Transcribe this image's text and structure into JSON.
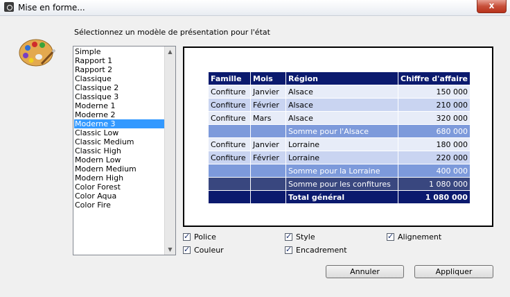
{
  "window": {
    "title": "Mise en forme...",
    "close_label": "x"
  },
  "prompt": "Sélectionnez un modèle de présentation pour l'état",
  "templates": {
    "items": [
      "Simple",
      "Rapport 1",
      "Rapport 2",
      "Classique",
      "Classique 2",
      "Classique 3",
      "Moderne 1",
      "Moderne 2",
      "Moderne 3",
      "Classic Low",
      "Classic Medium",
      "Classic High",
      "Modern Low",
      "Modern Medium",
      "Modern High",
      "Color Forest",
      "Color Aqua",
      "Color Fire"
    ],
    "selected": "Moderne 3"
  },
  "preview": {
    "headers": [
      "Famille",
      "Mois",
      "Région",
      "Chiffre d'affaire"
    ],
    "rows": [
      [
        "Confiture",
        "Janvier",
        "Alsace",
        "150 000"
      ],
      [
        "Confiture",
        "Février",
        "Alsace",
        "210 000"
      ],
      [
        "Confiture",
        "Mars",
        "Alsace",
        "320 000"
      ],
      [
        "",
        "",
        "Somme pour l'Alsace",
        "680 000"
      ],
      [
        "Confiture",
        "Janvier",
        "Lorraine",
        "180 000"
      ],
      [
        "Confiture",
        "Février",
        "Lorraine",
        "220 000"
      ],
      [
        "",
        "",
        "Somme pour la Lorraine",
        "400 000"
      ],
      [
        "",
        "",
        "Somme pour les confitures",
        "1 080 000"
      ],
      [
        "",
        "",
        "Total général",
        "1 080 000"
      ]
    ]
  },
  "options": {
    "police": "Police",
    "couleur": "Couleur",
    "style": "Style",
    "encadrement": "Encadrement",
    "alignement": "Alignement"
  },
  "buttons": {
    "cancel": "Annuler",
    "apply": "Appliquer"
  },
  "colors": {
    "selection": "#3399ff",
    "header": "#0b1a6e",
    "sum": "#7d9adb",
    "sum_dark": "#39477f"
  }
}
